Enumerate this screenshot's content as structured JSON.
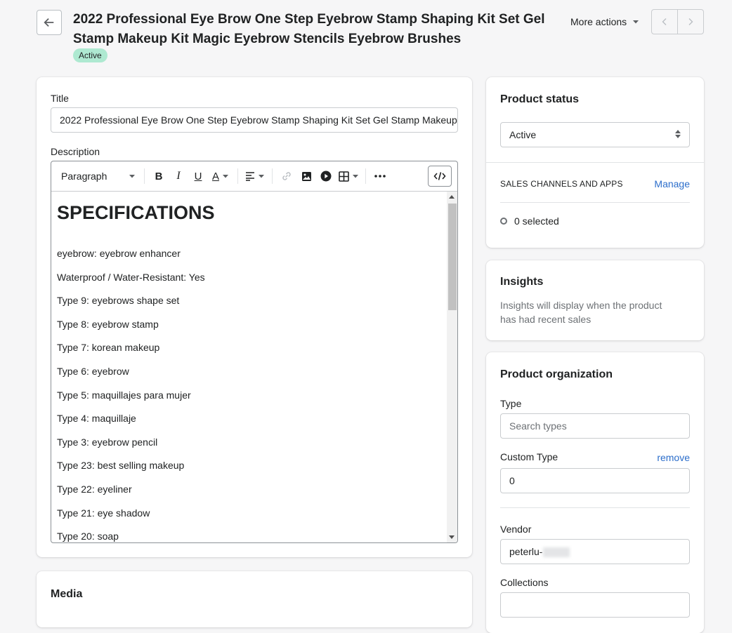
{
  "header": {
    "title": "2022 Professional Eye Brow One Step Eyebrow Stamp Shaping Kit Set Gel Stamp Makeup Kit Magic Eyebrow Stencils Eyebrow Brushes",
    "status_badge": "Active",
    "more_actions_label": "More actions"
  },
  "main": {
    "title_label": "Title",
    "title_value": "2022 Professional Eye Brow One Step Eyebrow Stamp Shaping Kit Set Gel Stamp Makeup Kit Magic Eyebrow Stencils Eyebrow Brushes",
    "description_label": "Description",
    "toolbar": {
      "paragraph_label": "Paragraph",
      "bold": "B",
      "italic": "I",
      "underline": "U",
      "text_color": "A"
    },
    "description": {
      "heading": "SPECIFICATIONS",
      "lines": [
        "eyebrow: eyebrow enhancer",
        "Waterproof / Water-Resistant: Yes",
        "Type 9: eyebrows shape set",
        "Type 8: eyebrow stamp",
        "Type 7: korean makeup",
        "Type 6: eyebrow",
        "Type 5: maquillajes para mujer",
        "Type 4: maquillaje",
        "Type 3: eyebrow pencil",
        "Type 23: best selling makeup",
        "Type 22: eyeliner",
        "Type 21: eye shadow",
        "Type 20: soap"
      ]
    },
    "media_title": "Media"
  },
  "status_card": {
    "title": "Product status",
    "selected": "Active",
    "channels_heading": "SALES CHANNELS AND APPS",
    "manage_label": "Manage",
    "selected_count": "0 selected"
  },
  "insights": {
    "title": "Insights",
    "body": "Insights will display when the product has had recent sales"
  },
  "organization": {
    "title": "Product organization",
    "type_label": "Type",
    "type_placeholder": "Search types",
    "custom_type_label": "Custom Type",
    "remove_label": "remove",
    "custom_type_value": "0",
    "vendor_label": "Vendor",
    "vendor_value": "peterlu-",
    "collections_label": "Collections"
  },
  "colors": {
    "badge_bg": "#aee9d1",
    "link": "#2c6ecb",
    "page_bg": "#f6f6f7"
  }
}
